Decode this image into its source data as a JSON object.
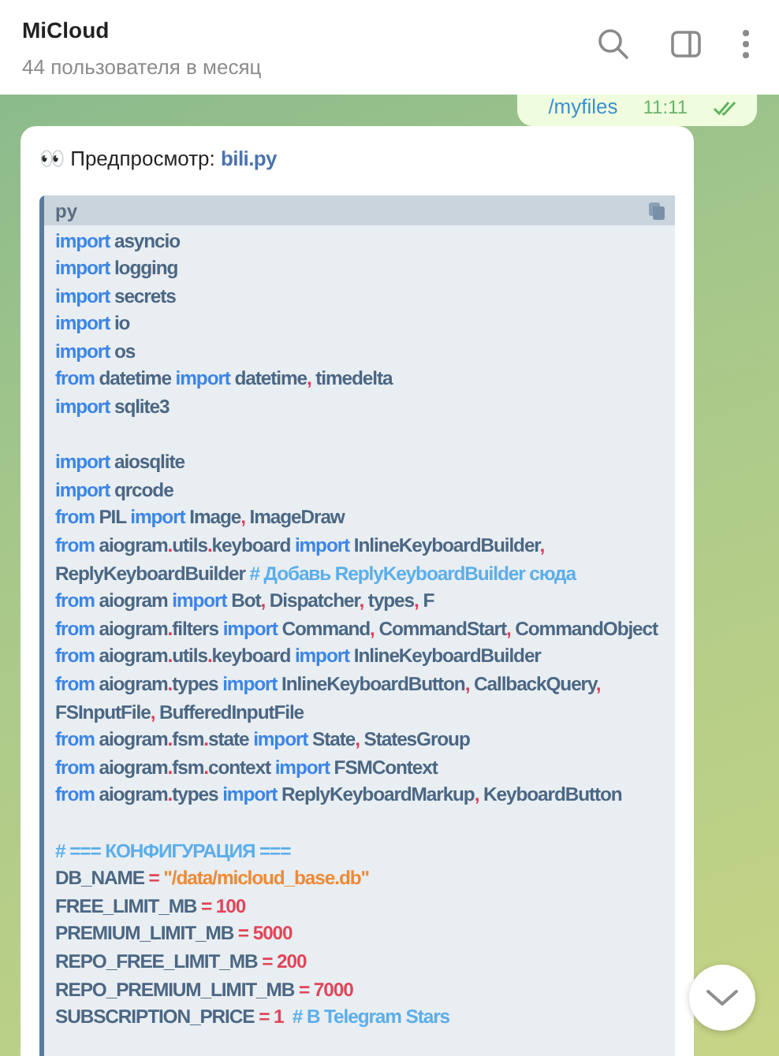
{
  "header": {
    "title": "MiCloud",
    "subtitle": "44 пользователя в месяц"
  },
  "sent_message": {
    "text": "/myfiles",
    "time": "11:11",
    "read": true
  },
  "preview": {
    "label": "👀 Предпросмотр:",
    "file": "bili.py",
    "code": {
      "language": "py",
      "lines": [
        {
          "kind": "code",
          "tokens": [
            {
              "kind": "keyword",
              "t": "import"
            },
            {
              "kind": "name",
              "t": " asyncio"
            }
          ]
        },
        {
          "kind": "code",
          "tokens": [
            {
              "kind": "keyword",
              "t": "import"
            },
            {
              "kind": "name",
              "t": " logging"
            }
          ]
        },
        {
          "kind": "code",
          "tokens": [
            {
              "kind": "keyword",
              "t": "import"
            },
            {
              "kind": "name",
              "t": " secrets"
            }
          ]
        },
        {
          "kind": "code",
          "tokens": [
            {
              "kind": "keyword",
              "t": "import"
            },
            {
              "kind": "name",
              "t": " io"
            }
          ]
        },
        {
          "kind": "code",
          "tokens": [
            {
              "kind": "keyword",
              "t": "import"
            },
            {
              "kind": "name",
              "t": " os"
            }
          ]
        },
        {
          "kind": "code",
          "tokens": [
            {
              "kind": "keyword",
              "t": "from"
            },
            {
              "kind": "name",
              "t": " datetime "
            },
            {
              "kind": "keyword",
              "t": "import"
            },
            {
              "kind": "name",
              "t": " datetime"
            },
            {
              "kind": "punct",
              "t": ","
            },
            {
              "kind": "name",
              "t": " timedelta"
            }
          ]
        },
        {
          "kind": "code",
          "tokens": [
            {
              "kind": "keyword",
              "t": "import"
            },
            {
              "kind": "name",
              "t": " sqlite3"
            }
          ]
        },
        {
          "kind": "blank"
        },
        {
          "kind": "code",
          "tokens": [
            {
              "kind": "keyword",
              "t": "import"
            },
            {
              "kind": "name",
              "t": " aiosqlite"
            }
          ]
        },
        {
          "kind": "code",
          "tokens": [
            {
              "kind": "keyword",
              "t": "import"
            },
            {
              "kind": "name",
              "t": " qrcode"
            }
          ]
        },
        {
          "kind": "code",
          "tokens": [
            {
              "kind": "keyword",
              "t": "from"
            },
            {
              "kind": "name",
              "t": " PIL "
            },
            {
              "kind": "keyword",
              "t": "import"
            },
            {
              "kind": "name",
              "t": " Image"
            },
            {
              "kind": "punct",
              "t": ","
            },
            {
              "kind": "name",
              "t": " ImageDraw"
            }
          ]
        },
        {
          "kind": "code",
          "tokens": [
            {
              "kind": "keyword",
              "t": "from"
            },
            {
              "kind": "name",
              "t": " aiogram"
            },
            {
              "kind": "punct",
              "t": "."
            },
            {
              "kind": "name",
              "t": "utils"
            },
            {
              "kind": "punct",
              "t": "."
            },
            {
              "kind": "name",
              "t": "keyboard "
            },
            {
              "kind": "keyword",
              "t": "import"
            },
            {
              "kind": "name",
              "t": " InlineKeyboardBuilder"
            },
            {
              "kind": "punct",
              "t": ","
            }
          ]
        },
        {
          "kind": "code",
          "tokens": [
            {
              "kind": "name",
              "t": "ReplyKeyboardBuilder "
            },
            {
              "kind": "comment",
              "t": "# Добавь ReplyKeyboardBuilder сюда"
            }
          ]
        },
        {
          "kind": "code",
          "tokens": [
            {
              "kind": "keyword",
              "t": "from"
            },
            {
              "kind": "name",
              "t": " aiogram "
            },
            {
              "kind": "keyword",
              "t": "import"
            },
            {
              "kind": "name",
              "t": " Bot"
            },
            {
              "kind": "punct",
              "t": ","
            },
            {
              "kind": "name",
              "t": " Dispatcher"
            },
            {
              "kind": "punct",
              "t": ","
            },
            {
              "kind": "name",
              "t": " types"
            },
            {
              "kind": "punct",
              "t": ","
            },
            {
              "kind": "name",
              "t": " F"
            }
          ]
        },
        {
          "kind": "code",
          "tokens": [
            {
              "kind": "keyword",
              "t": "from"
            },
            {
              "kind": "name",
              "t": " aiogram"
            },
            {
              "kind": "punct",
              "t": "."
            },
            {
              "kind": "name",
              "t": "filters "
            },
            {
              "kind": "keyword",
              "t": "import"
            },
            {
              "kind": "name",
              "t": " Command"
            },
            {
              "kind": "punct",
              "t": ","
            },
            {
              "kind": "name",
              "t": " CommandStart"
            },
            {
              "kind": "punct",
              "t": ","
            },
            {
              "kind": "name",
              "t": " CommandObject"
            }
          ]
        },
        {
          "kind": "code",
          "tokens": [
            {
              "kind": "keyword",
              "t": "from"
            },
            {
              "kind": "name",
              "t": " aiogram"
            },
            {
              "kind": "punct",
              "t": "."
            },
            {
              "kind": "name",
              "t": "utils"
            },
            {
              "kind": "punct",
              "t": "."
            },
            {
              "kind": "name",
              "t": "keyboard "
            },
            {
              "kind": "keyword",
              "t": "import"
            },
            {
              "kind": "name",
              "t": " InlineKeyboardBuilder"
            }
          ]
        },
        {
          "kind": "code",
          "tokens": [
            {
              "kind": "keyword",
              "t": "from"
            },
            {
              "kind": "name",
              "t": " aiogram"
            },
            {
              "kind": "punct",
              "t": "."
            },
            {
              "kind": "name",
              "t": "types "
            },
            {
              "kind": "keyword",
              "t": "import"
            },
            {
              "kind": "name",
              "t": " InlineKeyboardButton"
            },
            {
              "kind": "punct",
              "t": ","
            },
            {
              "kind": "name",
              "t": " CallbackQuery"
            },
            {
              "kind": "punct",
              "t": ","
            }
          ]
        },
        {
          "kind": "code",
          "tokens": [
            {
              "kind": "name",
              "t": "FSInputFile"
            },
            {
              "kind": "punct",
              "t": ","
            },
            {
              "kind": "name",
              "t": " BufferedInputFile"
            }
          ]
        },
        {
          "kind": "code",
          "tokens": [
            {
              "kind": "keyword",
              "t": "from"
            },
            {
              "kind": "name",
              "t": " aiogram"
            },
            {
              "kind": "punct",
              "t": "."
            },
            {
              "kind": "name",
              "t": "fsm"
            },
            {
              "kind": "punct",
              "t": "."
            },
            {
              "kind": "name",
              "t": "state "
            },
            {
              "kind": "keyword",
              "t": "import"
            },
            {
              "kind": "name",
              "t": " State"
            },
            {
              "kind": "punct",
              "t": ","
            },
            {
              "kind": "name",
              "t": " StatesGroup"
            }
          ]
        },
        {
          "kind": "code",
          "tokens": [
            {
              "kind": "keyword",
              "t": "from"
            },
            {
              "kind": "name",
              "t": " aiogram"
            },
            {
              "kind": "punct",
              "t": "."
            },
            {
              "kind": "name",
              "t": "fsm"
            },
            {
              "kind": "punct",
              "t": "."
            },
            {
              "kind": "name",
              "t": "context "
            },
            {
              "kind": "keyword",
              "t": "import"
            },
            {
              "kind": "name",
              "t": " FSMContext"
            }
          ]
        },
        {
          "kind": "code",
          "tokens": [
            {
              "kind": "keyword",
              "t": "from"
            },
            {
              "kind": "name",
              "t": " aiogram"
            },
            {
              "kind": "punct",
              "t": "."
            },
            {
              "kind": "name",
              "t": "types "
            },
            {
              "kind": "keyword",
              "t": "import"
            },
            {
              "kind": "name",
              "t": " ReplyKeyboardMarkup"
            },
            {
              "kind": "punct",
              "t": ","
            },
            {
              "kind": "name",
              "t": " KeyboardButton"
            }
          ]
        },
        {
          "kind": "blank"
        },
        {
          "kind": "code",
          "tokens": [
            {
              "kind": "comment",
              "t": "# === КОНФИГУРАЦИЯ ==="
            }
          ]
        },
        {
          "kind": "code",
          "tokens": [
            {
              "kind": "name",
              "t": "DB_NAME "
            },
            {
              "kind": "operator",
              "t": "="
            },
            {
              "kind": "string",
              "t": " \"/data/micloud_base.db\""
            }
          ]
        },
        {
          "kind": "code",
          "tokens": [
            {
              "kind": "name",
              "t": "FREE_LIMIT_MB "
            },
            {
              "kind": "operator",
              "t": "="
            },
            {
              "kind": "number",
              "t": " 100"
            }
          ]
        },
        {
          "kind": "code",
          "tokens": [
            {
              "kind": "name",
              "t": "PREMIUM_LIMIT_MB "
            },
            {
              "kind": "operator",
              "t": "="
            },
            {
              "kind": "number",
              "t": " 5000"
            }
          ]
        },
        {
          "kind": "code",
          "tokens": [
            {
              "kind": "name",
              "t": "REPO_FREE_LIMIT_MB "
            },
            {
              "kind": "operator",
              "t": "="
            },
            {
              "kind": "number",
              "t": " 200"
            }
          ]
        },
        {
          "kind": "code",
          "tokens": [
            {
              "kind": "name",
              "t": "REPO_PREMIUM_LIMIT_MB "
            },
            {
              "kind": "operator",
              "t": "="
            },
            {
              "kind": "number",
              "t": " 7000"
            }
          ]
        },
        {
          "kind": "code",
          "tokens": [
            {
              "kind": "name",
              "t": "SUBSCRIPTION_PRICE "
            },
            {
              "kind": "operator",
              "t": "="
            },
            {
              "kind": "number",
              "t": " 1 "
            },
            {
              "kind": "comment",
              "t": " # В Telegram Stars"
            }
          ]
        }
      ]
    }
  }
}
